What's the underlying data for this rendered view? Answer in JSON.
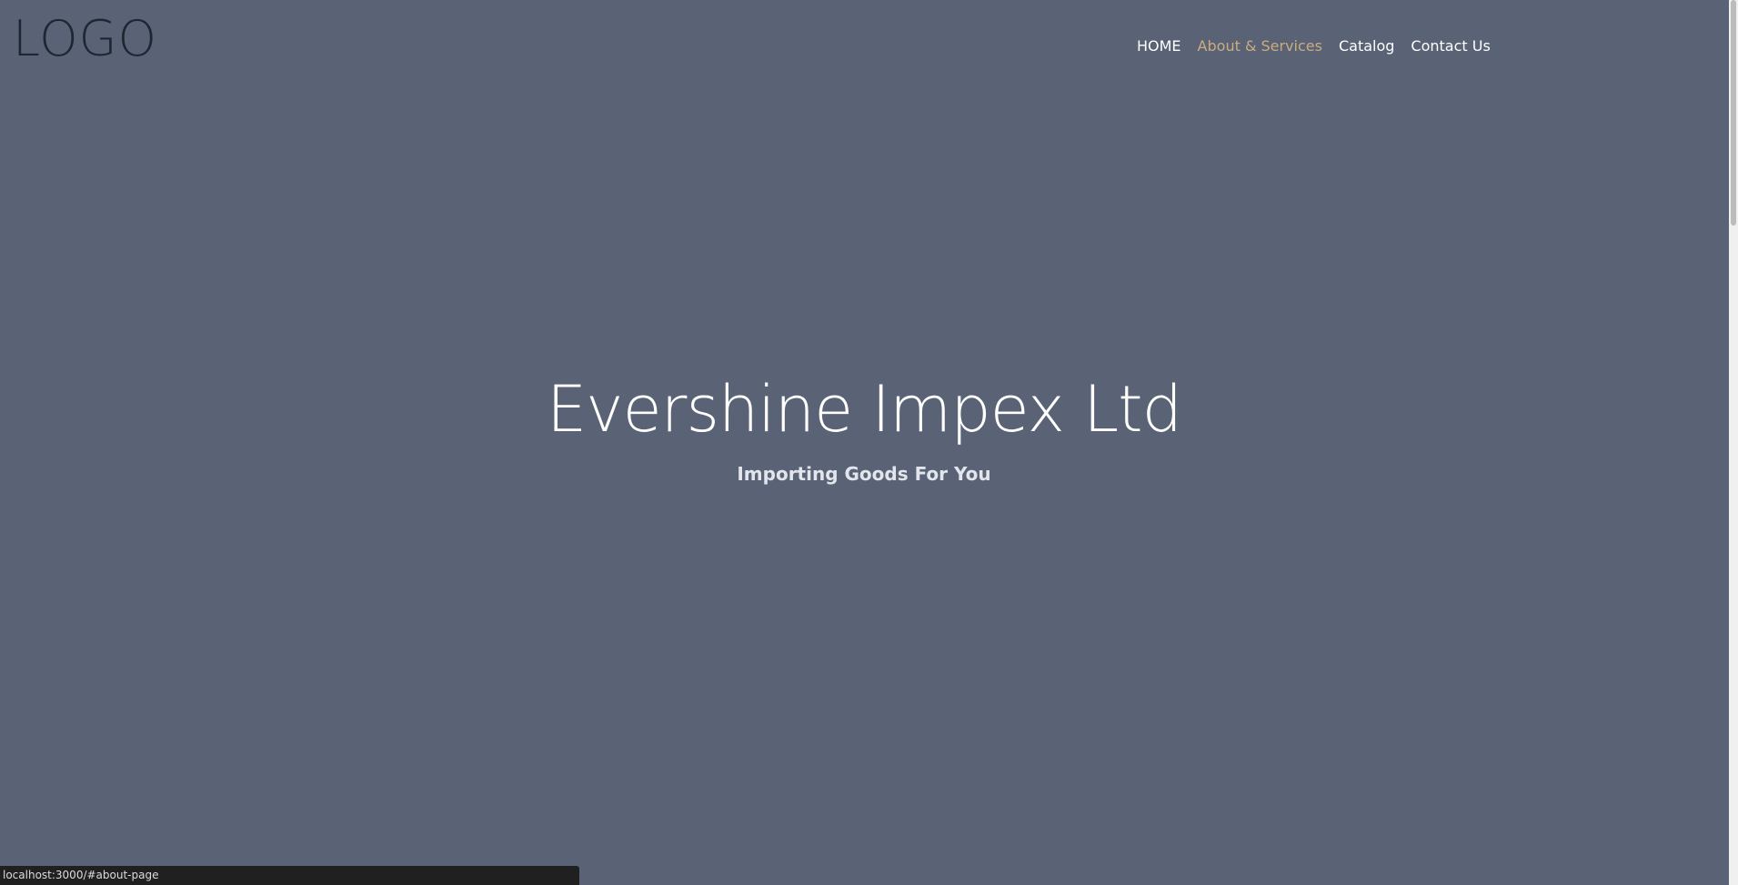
{
  "header": {
    "logo": "LOGO",
    "nav": [
      {
        "label": "HOME",
        "active": false
      },
      {
        "label": "About & Services",
        "active": true
      },
      {
        "label": "Catalog",
        "active": false
      },
      {
        "label": "Contact Us",
        "active": false
      }
    ]
  },
  "hero": {
    "title": "Evershine Impex Ltd",
    "subtitle": "Importing Goods For You"
  },
  "status_bar": {
    "url": "localhost:3000/#about-page"
  },
  "colors": {
    "background": "#5a6275",
    "nav_active": "#c9ad80",
    "logo": "#1f2633"
  }
}
